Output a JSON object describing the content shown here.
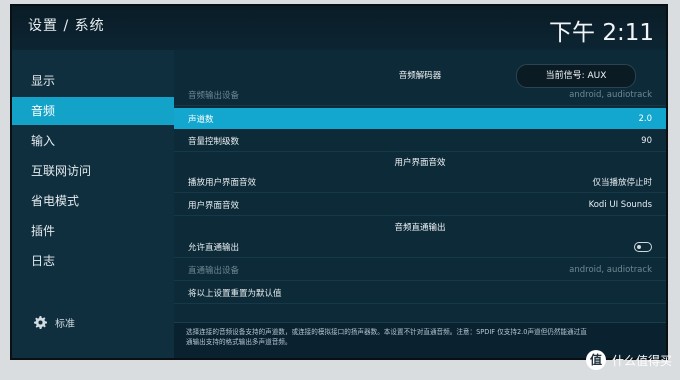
{
  "header": {
    "title": "设置 / 系统",
    "clock": "下午 2:11"
  },
  "signal": {
    "label": "当前信号: AUX"
  },
  "sidebar": {
    "items": [
      {
        "label": "显示"
      },
      {
        "label": "音频"
      },
      {
        "label": "输入"
      },
      {
        "label": "互联网访问"
      },
      {
        "label": "省电模式"
      },
      {
        "label": "插件"
      },
      {
        "label": "日志"
      }
    ],
    "level_label": "标准"
  },
  "sections": {
    "decoder": "音频解码器",
    "ui_sounds": "用户界面音效",
    "passthrough": "音频直通输出"
  },
  "rows": {
    "output_device": {
      "label": "音频输出设备",
      "value": "android, audiotrack"
    },
    "channels": {
      "label": "声道数",
      "value": "2.0"
    },
    "volume_steps": {
      "label": "音量控制级数",
      "value": "90"
    },
    "play_ui_sounds": {
      "label": "播放用户界面音效",
      "value": "仅当播放停止时"
    },
    "ui_sound_skin": {
      "label": "用户界面音效",
      "value": "Kodi UI Sounds"
    },
    "allow_passthrough": {
      "label": "允许直通输出"
    },
    "passthrough_device": {
      "label": "直通输出设备",
      "value": "android, audiotrack"
    },
    "reset": {
      "label": "将以上设置重置为默认值"
    }
  },
  "help": {
    "line1": "选择连接的音频设备支持的声道数，或连接的模拟接口的扬声器数。本设置不针对直通音频。注意：SPDIF  仅支持2.0声道但仍然能通过直",
    "line2": "通输出支持的格式输出多声道音频。"
  },
  "watermark": {
    "logo": "值",
    "text": "什么值得买"
  }
}
